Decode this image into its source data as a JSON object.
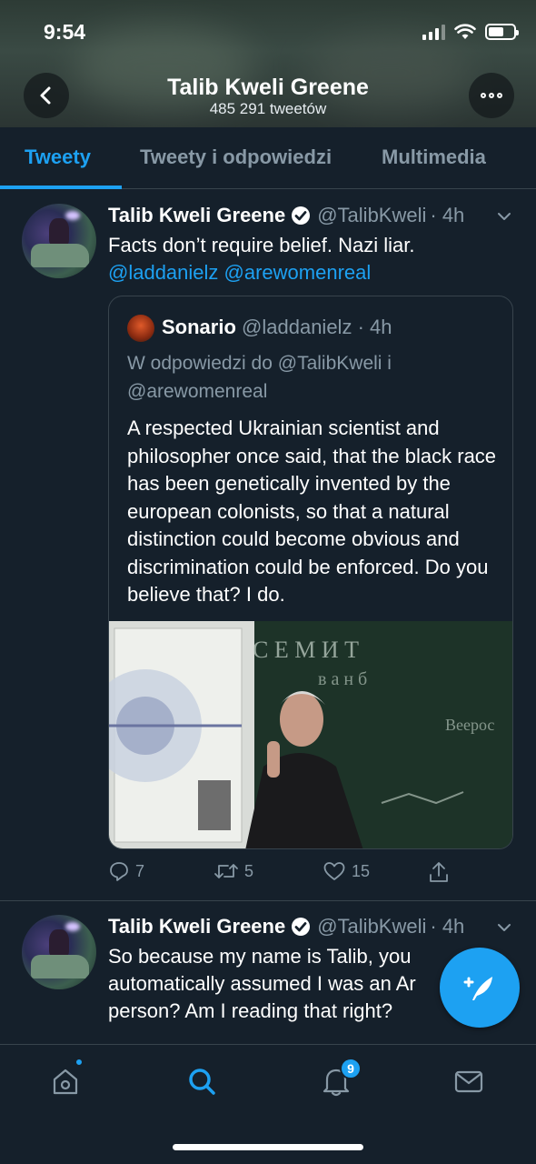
{
  "status_bar": {
    "time": "9:54",
    "battery_level": 0.6
  },
  "header": {
    "title": "Talib Kweli Greene",
    "subtitle": "485 291 tweetów"
  },
  "tabs": [
    {
      "label": "Tweety",
      "active": true
    },
    {
      "label": "Tweety i odpowiedzi",
      "active": false
    },
    {
      "label": "Multimedia",
      "active": false
    }
  ],
  "tweets": [
    {
      "name": "Talib Kweli Greene",
      "handle": "@TalibKweli",
      "time": "· 4h",
      "text": "Facts don’t require belief. Nazi liar.",
      "mentions": "@laddanielz @arewomenreal",
      "quote": {
        "name": "Sonario",
        "handle": "@laddanielz",
        "time": "· 4h",
        "reply_prefix": "W odpowiedzi do ",
        "reply_to": "@TalibKweli i @arewomenreal",
        "text": "A respected Ukrainian scientist and philosopher once said, that the black race has been genetically invented by the european colonists, so that a natural distinction could become obvious and discrimination could be enforced. Do you believe that? I do."
      },
      "replies": "7",
      "retweets": "5",
      "likes": "15"
    },
    {
      "name": "Talib Kweli Greene",
      "handle": "@TalibKweli",
      "time": "· 4h",
      "text": "So because my name is Talib, you automatically assumed I was an Ar person? Am I reading that right?"
    }
  ],
  "tab_bar": {
    "notifications_count": "9"
  },
  "colors": {
    "accent": "#1da1f2",
    "background": "#15202b",
    "muted": "#8899a6",
    "border": "#38444d"
  }
}
